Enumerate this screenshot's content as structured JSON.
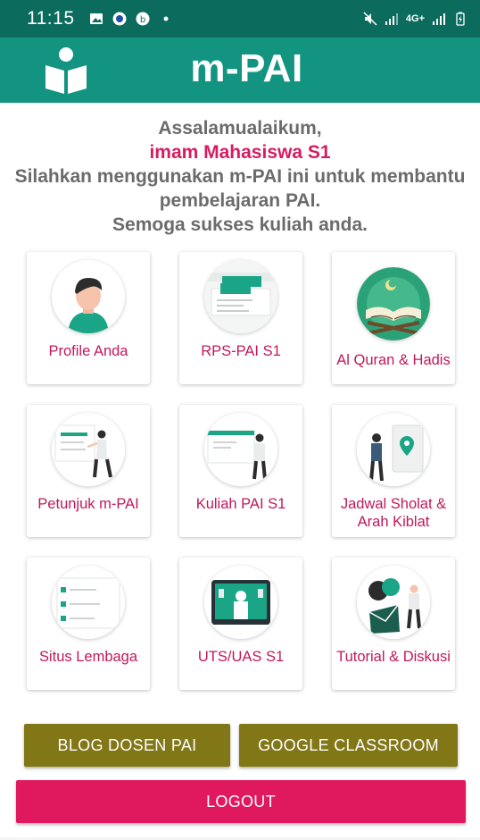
{
  "status_bar": {
    "time": "11:15",
    "network": "4G+"
  },
  "app_bar": {
    "title": "m-PAI",
    "logo_icon": "open-book-person-icon"
  },
  "greeting": {
    "line1": "Assalamualaikum,",
    "user": "imam Mahasiswa S1",
    "line3": "Silahkan menggunakan m-PAI ini untuk membantu",
    "line4": "pembelajaran PAI.",
    "line5": "Semoga sukses kuliah anda."
  },
  "menu": [
    {
      "label": "Profile Anda",
      "icon": "avatar-icon"
    },
    {
      "label": "RPS-PAI S1",
      "icon": "document-icon"
    },
    {
      "label": "Al Quran & Hadis",
      "icon": "quran-icon"
    },
    {
      "label": "Petunjuk m-PAI",
      "icon": "presentation-icon"
    },
    {
      "label": "Kuliah PAI S1",
      "icon": "lecture-icon"
    },
    {
      "label": "Jadwal Sholat & Arah Kiblat",
      "icon": "location-icon"
    },
    {
      "label": "Situs Lembaga",
      "icon": "website-icon"
    },
    {
      "label": "UTS/UAS S1",
      "icon": "exam-icon"
    },
    {
      "label": "Tutorial & Diskusi",
      "icon": "chat-icon"
    }
  ],
  "buttons": {
    "blog": "BLOG DOSEN PAI",
    "classroom": "GOOGLE CLASSROOM",
    "logout": "LOGOUT"
  },
  "colors": {
    "status_bar": "#0b6b5d",
    "app_bar": "#129481",
    "accent": "#d81b60",
    "olive": "#827717",
    "logout": "#e0195f"
  }
}
